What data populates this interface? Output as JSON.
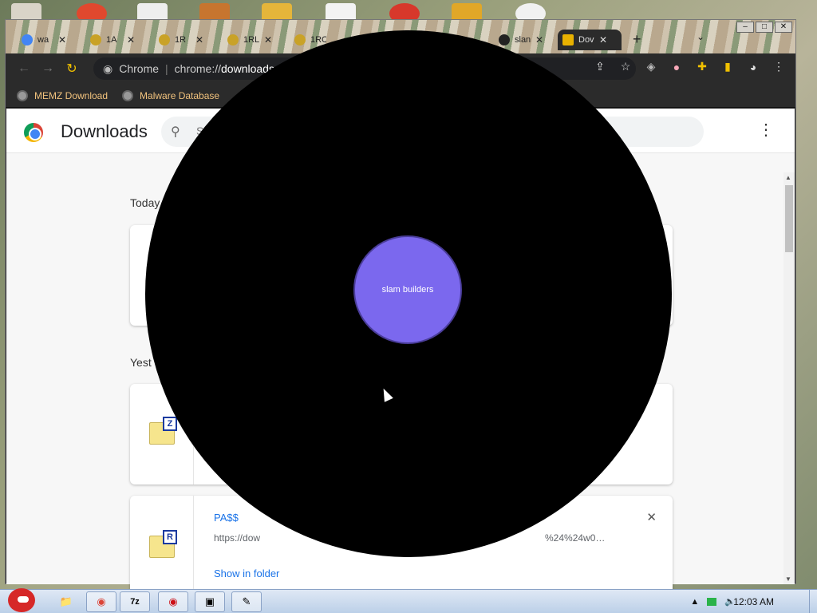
{
  "tabs": [
    {
      "label": "wa",
      "fav_color": "#4285f4",
      "active": false
    },
    {
      "label": "1A",
      "fav_color": "#c9a227",
      "active": false
    },
    {
      "label": "1R",
      "fav_color": "#c9a227",
      "active": false
    },
    {
      "label": "1RL",
      "fav_color": "#c9a227",
      "active": false
    },
    {
      "label": "1RC",
      "fav_color": "#c9a227",
      "active": false
    },
    {
      "label": "slan",
      "fav_color": "#222222",
      "active": false
    },
    {
      "label": "Dov",
      "fav_color": "#e8b100",
      "active": true
    }
  ],
  "window": {
    "minimize": "–",
    "maximize": "□",
    "close": "✕"
  },
  "toolbar": {
    "site_chip": "Chrome",
    "url_prefix": "chrome://",
    "url_path": "downloads"
  },
  "bookmarks": [
    {
      "label": "MEMZ Download"
    },
    {
      "label": "Malware Database"
    }
  ],
  "page": {
    "title": "Downloads",
    "search_placeholder": "S",
    "sections": [
      {
        "label": "Today"
      },
      {
        "label": "Yest"
      }
    ],
    "items": [
      {
        "name": "",
        "url": "",
        "show_label": "",
        "badge": "Z"
      },
      {
        "name": "PA$$",
        "url": "https://dow",
        "url_tail": "%24%24w0…",
        "show_label": "Show in folder",
        "badge": "R"
      }
    ]
  },
  "overlay": {
    "bubble_text": "slam builders"
  },
  "taskbar": {
    "clock": "12:03 AM"
  }
}
